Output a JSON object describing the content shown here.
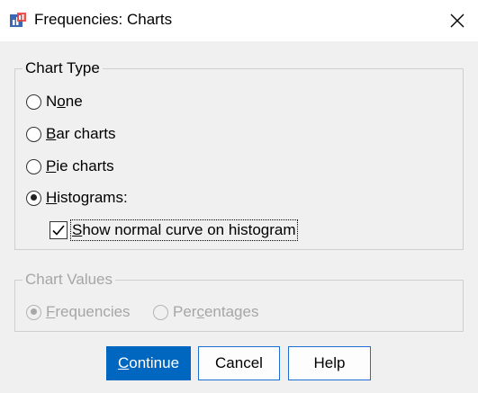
{
  "window": {
    "title": "Frequencies: Charts"
  },
  "chart_type": {
    "legend": "Chart Type",
    "options": [
      {
        "prefix": "N",
        "mnemonic": "o",
        "suffix": "ne",
        "selected": false
      },
      {
        "prefix": "",
        "mnemonic": "B",
        "suffix": "ar charts",
        "selected": false
      },
      {
        "prefix": "",
        "mnemonic": "P",
        "suffix": "ie charts",
        "selected": false
      },
      {
        "prefix": "",
        "mnemonic": "H",
        "suffix": "istograms:",
        "selected": true
      }
    ],
    "normal_curve": {
      "mnemonic": "S",
      "suffix": "how normal curve on histogram",
      "checked": true
    }
  },
  "chart_values": {
    "legend": "Chart Values",
    "enabled": false,
    "options": [
      {
        "prefix": "",
        "mnemonic": "F",
        "suffix": "requencies",
        "selected": true
      },
      {
        "prefix": "Per",
        "mnemonic": "c",
        "suffix": "entages",
        "selected": false
      }
    ]
  },
  "buttons": {
    "continue": {
      "mnemonic": "C",
      "suffix": "ontinue"
    },
    "cancel": "Cancel",
    "help": "Help"
  },
  "colors": {
    "primary_button": "#0067c0",
    "button_border": "#1c6fd1",
    "disabled_text": "#a6a6a6"
  }
}
